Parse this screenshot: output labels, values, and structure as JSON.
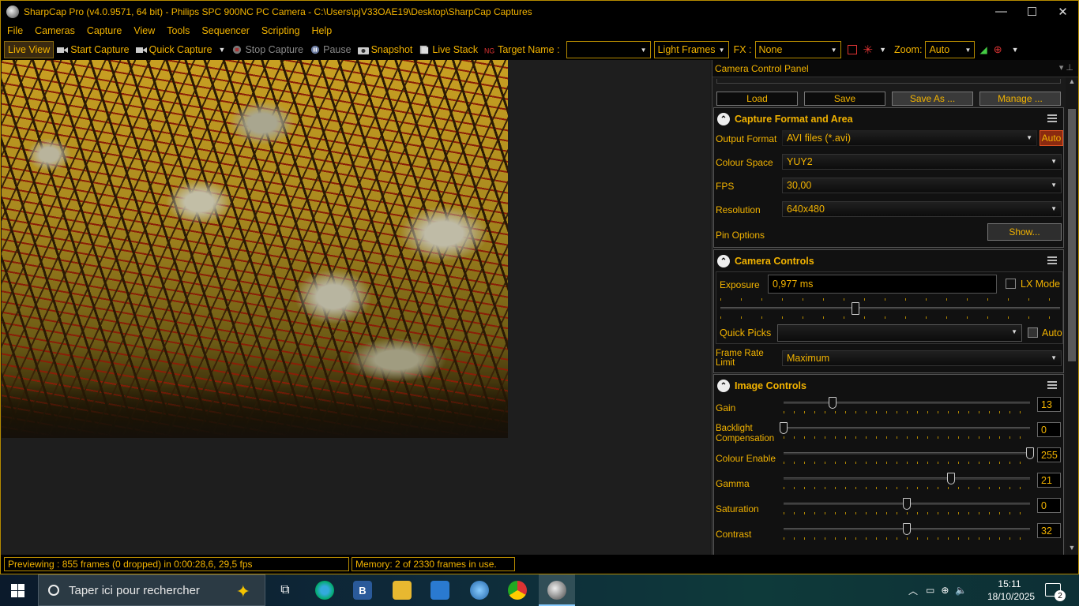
{
  "window": {
    "title": "SharpCap Pro (v4.0.9571, 64 bit) - Philips SPC 900NC PC Camera - C:\\Users\\pjV33OAE19\\Desktop\\SharpCap Captures",
    "min": "—",
    "max": "☐",
    "close": "✕"
  },
  "menu": [
    "File",
    "Cameras",
    "Capture",
    "View",
    "Tools",
    "Sequencer",
    "Scripting",
    "Help"
  ],
  "toolbar": {
    "live_view": "Live View",
    "start_capture": "Start Capture",
    "quick_capture": "Quick Capture",
    "stop_capture": "Stop Capture",
    "pause": "Pause",
    "snapshot": "Snapshot",
    "live_stack": "Live Stack",
    "target_name_label": "Target Name :",
    "target_name_value": "",
    "frame_type": "Light Frames",
    "fx_label": "FX :",
    "fx_value": "None",
    "zoom_label": "Zoom:",
    "zoom_value": "Auto"
  },
  "panel": {
    "title": "Camera Control Panel",
    "profile_buttons": [
      "Load",
      "Save",
      "Save As ...",
      "Manage ..."
    ],
    "capture_format": {
      "title": "Capture Format and Area",
      "output_format_label": "Output Format",
      "output_format_value": "AVI files (*.avi)",
      "auto_label": "Auto",
      "colour_space_label": "Colour Space",
      "colour_space_value": "YUY2",
      "fps_label": "FPS",
      "fps_value": "30,00",
      "resolution_label": "Resolution",
      "resolution_value": "640x480",
      "pin_options_label": "Pin Options",
      "show_button": "Show..."
    },
    "camera_controls": {
      "title": "Camera Controls",
      "exposure_label": "Exposure",
      "exposure_value": "0,977 ms",
      "lx_mode_label": "LX Mode",
      "quick_picks_label": "Quick Picks",
      "quick_picks_value": "",
      "auto_label": "Auto",
      "frame_rate_label": "Frame Rate Limit",
      "frame_rate_value": "Maximum"
    },
    "image_controls": {
      "title": "Image Controls",
      "controls": [
        {
          "label": "Gain",
          "value": "13",
          "level": 0.2
        },
        {
          "label": "Backlight Compensation",
          "value": "0",
          "level": 0.0
        },
        {
          "label": "Colour Enable",
          "value": "255",
          "level": 1.0
        },
        {
          "label": "Gamma",
          "value": "21",
          "level": 0.68
        },
        {
          "label": "Saturation",
          "value": "0",
          "level": 0.5
        },
        {
          "label": "Contrast",
          "value": "32",
          "level": 0.5
        }
      ]
    }
  },
  "status": {
    "previewing": "Previewing : 855 frames (0 dropped) in 0:00:28,6, 29,5 fps",
    "memory": "Memory: 2 of 2330 frames in use."
  },
  "taskbar": {
    "search_placeholder": "Taper ici pour rechercher",
    "time": "15:11",
    "date": "18/10/2025",
    "notifications": "2"
  },
  "colors": {
    "accent": "#f2b300",
    "background": "#1a1a1a",
    "border": "#b58a00"
  }
}
